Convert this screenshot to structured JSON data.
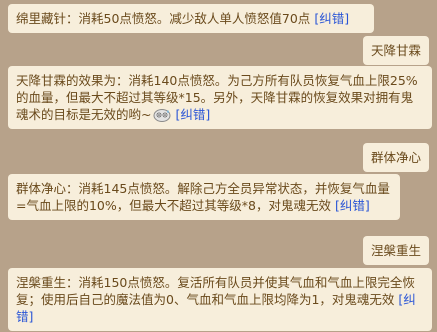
{
  "messages": [
    {
      "from": "bot",
      "text": "绵里藏针：消耗50点愤怒。减少敌人单人愤怒值70点",
      "link": "[纠错]"
    },
    {
      "from": "me",
      "text": "天降甘霖"
    },
    {
      "from": "bot",
      "text": "天降甘霖的效果为：消耗140点愤怒。为己方所有队员恢复气血上限25%的血量，但最大不超过其等级*15。另外，天降甘霖的恢复效果对拥有鬼魂术的目标是无效的哟~",
      "emoji": "sweat-face-emoji",
      "link": "[纠错]"
    },
    {
      "from": "me",
      "text": "群体净心"
    },
    {
      "from": "bot",
      "text": "群体净心：消耗145点愤怒。解除己方全员异常状态，并恢复气血量=气血上限的10%，但最大不超过其等级*8，对鬼魂无效",
      "link": "[纠错]"
    },
    {
      "from": "me",
      "text": "涅槃重生"
    },
    {
      "from": "bot",
      "text": "涅槃重生：消耗150点愤怒。复活所有队员并使其气血和气血上限完全恢复；使用后自己的魔法值为0、气血和气血上限均降为1，对鬼魂无效",
      "link": "[纠错]"
    }
  ]
}
